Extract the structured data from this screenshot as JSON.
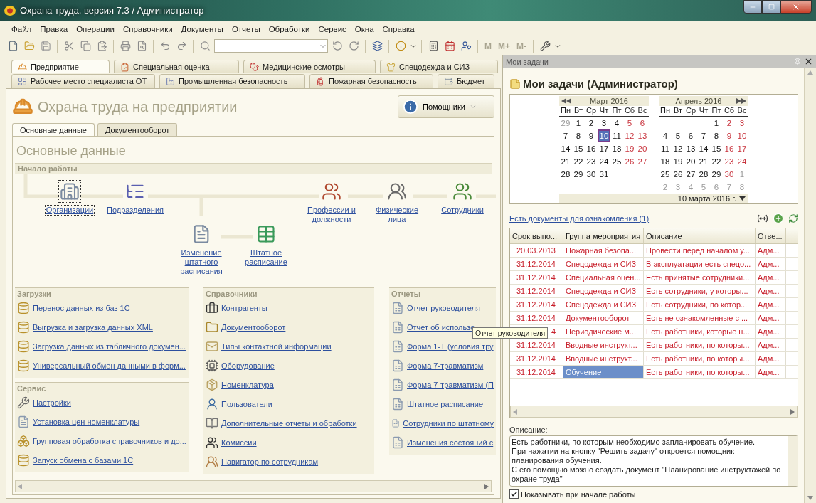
{
  "window": {
    "title": "Охрана труда, версия 7.3 / Администратор"
  },
  "menu": [
    "Файл",
    "Правка",
    "Операции",
    "Справочники",
    "Документы",
    "Отчеты",
    "Обработки",
    "Сервис",
    "Окна",
    "Справка"
  ],
  "toolbar": {
    "memory_buttons": [
      {
        "label": "M",
        "disabled": true
      },
      {
        "label": "M+",
        "disabled": true
      },
      {
        "label": "M-",
        "disabled": true
      }
    ]
  },
  "section_tabs": [
    [
      {
        "label": "Предприятие",
        "selected": true
      },
      {
        "label": "Специальная оценка",
        "selected": false
      },
      {
        "label": "Медицинские осмотры",
        "selected": false
      },
      {
        "label": "Спецодежда и СИЗ",
        "selected": false
      }
    ],
    [
      {
        "label": "Рабочее место специалиста ОТ",
        "selected": false
      },
      {
        "label": "Промышленная безопасность",
        "selected": false
      },
      {
        "label": "Пожарная безопасность",
        "selected": false
      },
      {
        "label": "Бюджет",
        "selected": false
      }
    ]
  ],
  "page": {
    "title": "Охрана труда на предприятии",
    "assistants_button": "Помощники",
    "tabs": [
      {
        "label": "Основные данные",
        "selected": true
      },
      {
        "label": "Документооборот",
        "selected": false
      }
    ],
    "panel_title": "Основные данные",
    "start_section": {
      "title": "Начало работы",
      "nodes": [
        {
          "label": "Организации",
          "focused": true
        },
        {
          "label": "Подразделения",
          "focused": false
        },
        {
          "label": "Изменение штатного расписания",
          "focused": false
        },
        {
          "label": "Штатное расписание",
          "focused": false
        },
        {
          "label": "Профессии и должности",
          "focused": false
        },
        {
          "label": "Физические лица",
          "focused": false
        },
        {
          "label": "Сотрудники",
          "focused": false
        }
      ]
    },
    "columns": [
      [
        {
          "title": "Загрузки",
          "links": [
            "Перенос данных из баз 1С",
            "Выгрузка и загрузка данных XML",
            "Загрузка данных из табличного докумен...",
            "Универсальный обмен данными в форм..."
          ]
        },
        {
          "title": "Сервис",
          "links": [
            "Настройки",
            "Установка цен номенклатуры",
            "Групповая обработка справочников и до...",
            "Запуск обмена с базами 1С"
          ]
        }
      ],
      [
        {
          "title": "Справочники",
          "links": [
            "Контрагенты",
            "Документооборот",
            "Типы контактной информации",
            "Оборудование",
            "Номенклатура",
            "Пользователи",
            "Дополнительные отчеты и обработки",
            "Комиссии",
            "Навигатор по сотрудникам"
          ]
        }
      ],
      [
        {
          "title": "Отчеты",
          "links": [
            "Отчет руководителя",
            "Отчет об использо",
            "Форма 1-Т (условия тру",
            "Форма 7-травматизм",
            "Форма 7-травматизм (П",
            "Штатное расписание",
            "Сотрудники по штатному",
            "Изменения состояний с"
          ]
        }
      ]
    ]
  },
  "tooltip": "Отчет руководителя",
  "tasks": {
    "panel_title": "Мои задачи",
    "heading": "Мои задачи (Администратор)",
    "calendar": {
      "months": [
        {
          "title": "Март 2016",
          "weekdays": [
            "Пн",
            "Вт",
            "Ср",
            "Чт",
            "Пт",
            "Сб",
            "Вс"
          ],
          "weeks": [
            {
              "days": [
                {
                  "d": "29",
                  "kind": "other",
                  "selected": false
                },
                {
                  "d": "1",
                  "kind": "day",
                  "selected": false
                },
                {
                  "d": "2",
                  "kind": "day",
                  "selected": false
                },
                {
                  "d": "3",
                  "kind": "day",
                  "selected": false
                },
                {
                  "d": "4",
                  "kind": "day",
                  "selected": false
                },
                {
                  "d": "5",
                  "kind": "weekend",
                  "selected": false
                },
                {
                  "d": "6",
                  "kind": "weekend",
                  "selected": false
                }
              ]
            },
            {
              "days": [
                {
                  "d": "7",
                  "kind": "day",
                  "selected": false
                },
                {
                  "d": "8",
                  "kind": "day",
                  "selected": false
                },
                {
                  "d": "9",
                  "kind": "day",
                  "selected": false
                },
                {
                  "d": "10",
                  "kind": "day",
                  "selected": true
                },
                {
                  "d": "11",
                  "kind": "day",
                  "selected": false
                },
                {
                  "d": "12",
                  "kind": "weekend",
                  "selected": false
                },
                {
                  "d": "13",
                  "kind": "weekend",
                  "selected": false
                }
              ]
            },
            {
              "days": [
                {
                  "d": "14",
                  "kind": "day",
                  "selected": false
                },
                {
                  "d": "15",
                  "kind": "day",
                  "selected": false
                },
                {
                  "d": "16",
                  "kind": "day",
                  "selected": false
                },
                {
                  "d": "17",
                  "kind": "day",
                  "selected": false
                },
                {
                  "d": "18",
                  "kind": "day",
                  "selected": false
                },
                {
                  "d": "19",
                  "kind": "weekend",
                  "selected": false
                },
                {
                  "d": "20",
                  "kind": "weekend",
                  "selected": false
                }
              ]
            },
            {
              "days": [
                {
                  "d": "21",
                  "kind": "day",
                  "selected": false
                },
                {
                  "d": "22",
                  "kind": "day",
                  "selected": false
                },
                {
                  "d": "23",
                  "kind": "day",
                  "selected": false
                },
                {
                  "d": "24",
                  "kind": "day",
                  "selected": false
                },
                {
                  "d": "25",
                  "kind": "day",
                  "selected": false
                },
                {
                  "d": "26",
                  "kind": "weekend",
                  "selected": false
                },
                {
                  "d": "27",
                  "kind": "weekend",
                  "selected": false
                }
              ]
            },
            {
              "days": [
                {
                  "d": "28",
                  "kind": "day",
                  "selected": false
                },
                {
                  "d": "29",
                  "kind": "day",
                  "selected": false
                },
                {
                  "d": "30",
                  "kind": "day",
                  "selected": false
                },
                {
                  "d": "31",
                  "kind": "day",
                  "selected": false
                }
              ]
            }
          ]
        },
        {
          "title": "Апрель 2016",
          "weekdays": [
            "Пн",
            "Вт",
            "Ср",
            "Чт",
            "Пт",
            "Сб",
            "Вс"
          ],
          "weeks": [
            {
              "days": [
                {
                  "kind": "blank"
                },
                {
                  "kind": "blank"
                },
                {
                  "kind": "blank"
                },
                {
                  "kind": "blank"
                },
                {
                  "d": "1",
                  "kind": "day",
                  "selected": false
                },
                {
                  "d": "2",
                  "kind": "weekend",
                  "selected": false
                },
                {
                  "d": "3",
                  "kind": "weekend",
                  "selected": false
                }
              ]
            },
            {
              "days": [
                {
                  "d": "4",
                  "kind": "day",
                  "selected": false
                },
                {
                  "d": "5",
                  "kind": "day",
                  "selected": false
                },
                {
                  "d": "6",
                  "kind": "day",
                  "selected": false
                },
                {
                  "d": "7",
                  "kind": "day",
                  "selected": false
                },
                {
                  "d": "8",
                  "kind": "day",
                  "selected": false
                },
                {
                  "d": "9",
                  "kind": "weekend",
                  "selected": false
                },
                {
                  "d": "10",
                  "kind": "weekend",
                  "selected": false
                }
              ]
            },
            {
              "days": [
                {
                  "d": "11",
                  "kind": "day",
                  "selected": false
                },
                {
                  "d": "12",
                  "kind": "day",
                  "selected": false
                },
                {
                  "d": "13",
                  "kind": "day",
                  "selected": false
                },
                {
                  "d": "14",
                  "kind": "day",
                  "selected": false
                },
                {
                  "d": "15",
                  "kind": "day",
                  "selected": false
                },
                {
                  "d": "16",
                  "kind": "weekend",
                  "selected": false
                },
                {
                  "d": "17",
                  "kind": "weekend",
                  "selected": false
                }
              ]
            },
            {
              "days": [
                {
                  "d": "18",
                  "kind": "day",
                  "selected": false
                },
                {
                  "d": "19",
                  "kind": "day",
                  "selected": false
                },
                {
                  "d": "20",
                  "kind": "day",
                  "selected": false
                },
                {
                  "d": "21",
                  "kind": "day",
                  "selected": false
                },
                {
                  "d": "22",
                  "kind": "day",
                  "selected": false
                },
                {
                  "d": "23",
                  "kind": "weekend",
                  "selected": false
                },
                {
                  "d": "24",
                  "kind": "weekend",
                  "selected": false
                }
              ]
            },
            {
              "days": [
                {
                  "d": "25",
                  "kind": "day",
                  "selected": false
                },
                {
                  "d": "26",
                  "kind": "day",
                  "selected": false
                },
                {
                  "d": "27",
                  "kind": "day",
                  "selected": false
                },
                {
                  "d": "28",
                  "kind": "day",
                  "selected": false
                },
                {
                  "d": "29",
                  "kind": "day",
                  "selected": false
                },
                {
                  "d": "30",
                  "kind": "weekend",
                  "selected": false
                },
                {
                  "d": "1",
                  "kind": "other",
                  "selected": false
                }
              ]
            },
            {
              "days": [
                {
                  "d": "2",
                  "kind": "other",
                  "selected": false
                },
                {
                  "d": "3",
                  "kind": "other",
                  "selected": false
                },
                {
                  "d": "4",
                  "kind": "other",
                  "selected": false
                },
                {
                  "d": "5",
                  "kind": "other",
                  "selected": false
                },
                {
                  "d": "6",
                  "kind": "other",
                  "selected": false
                },
                {
                  "d": "7",
                  "kind": "other",
                  "selected": false
                },
                {
                  "d": "8",
                  "kind": "other",
                  "selected": false
                }
              ]
            }
          ]
        }
      ],
      "current_date": "10 марта 2016 г."
    },
    "docs_link": "Есть документы для ознакомления (1)",
    "table": {
      "columns": [
        {
          "label": "Срок выпо...",
          "current": false
        },
        {
          "label": "Группа мероприятия",
          "current": true
        },
        {
          "label": "Описание",
          "current": false
        },
        {
          "label": "Отве...",
          "current": false
        }
      ],
      "rows": [
        {
          "cells": [
            "20.03.2013",
            "Пожарная безопа...",
            "Провести перед началом у...",
            "Адм..."
          ],
          "overdue": true,
          "selected": false
        },
        {
          "cells": [
            "31.12.2014",
            "Спецодежда и СИЗ",
            "В эксплуатации есть спецо...",
            "Адм..."
          ],
          "overdue": true,
          "selected": false
        },
        {
          "cells": [
            "31.12.2014",
            "Специальная оцен...",
            "Есть принятые сотрудники...",
            "Адм..."
          ],
          "overdue": true,
          "selected": false
        },
        {
          "cells": [
            "31.12.2014",
            "Спецодежда и СИЗ",
            "Есть сотрудники, у которы...",
            "Адм..."
          ],
          "overdue": true,
          "selected": false
        },
        {
          "cells": [
            "31.12.2014",
            "Спецодежда и СИЗ",
            "Есть сотрудники, по котор...",
            "Адм..."
          ],
          "overdue": true,
          "selected": false
        },
        {
          "cells": [
            "31.12.2014",
            "Документооборот",
            "Есть не ознакомленные с ...",
            "Адм..."
          ],
          "overdue": true,
          "selected": false
        },
        {
          "cells": [
            "4",
            "Периодические м...",
            "Есть работники, которые н...",
            "Адм..."
          ],
          "overdue": true,
          "selected": false
        },
        {
          "cells": [
            "31.12.2014",
            "Вводные инструкт...",
            "Есть работники, по которы...",
            "Адм..."
          ],
          "overdue": true,
          "selected": false
        },
        {
          "cells": [
            "31.12.2014",
            "Вводные инструкт...",
            "Есть работники, по которы...",
            "Адм..."
          ],
          "overdue": true,
          "selected": false
        },
        {
          "cells": [
            "31.12.2014",
            "Обучение",
            "Есть работники, по которы...",
            "Адм..."
          ],
          "overdue": true,
          "selected": true
        }
      ]
    },
    "description_label": "Описание:",
    "description": "Есть работники, по которым необходимо запланировать обучение.\nПри нажатии на кнопку \"Решить задачу\" откроется помощник планирования обучения.\nС его помощью можно создать документ \"Планирование инструктажей по охране труда\"",
    "show_on_start": {
      "label": "Показывать при начале работы",
      "checked": true
    }
  }
}
